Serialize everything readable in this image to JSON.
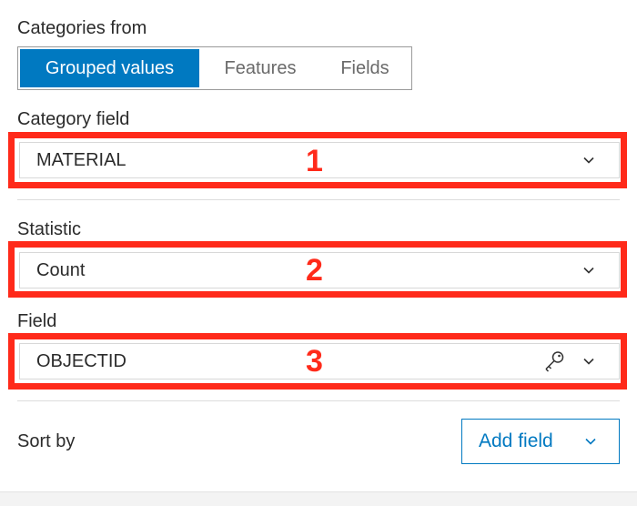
{
  "categories_from": {
    "label": "Categories from",
    "options": [
      "Grouped values",
      "Features",
      "Fields"
    ],
    "selected": "Grouped values"
  },
  "category_field": {
    "label": "Category field",
    "value": "MATERIAL",
    "annotation": "1"
  },
  "statistic": {
    "label": "Statistic",
    "value": "Count",
    "annotation": "2"
  },
  "field": {
    "label": "Field",
    "value": "OBJECTID",
    "annotation": "3"
  },
  "sort_by": {
    "label": "Sort by",
    "button_label": "Add field"
  },
  "colors": {
    "accent": "#0079c1",
    "annotation_red": "#ff2a1a"
  },
  "icons": {
    "dropdown": "chevron-down-icon",
    "key": "key-icon"
  }
}
